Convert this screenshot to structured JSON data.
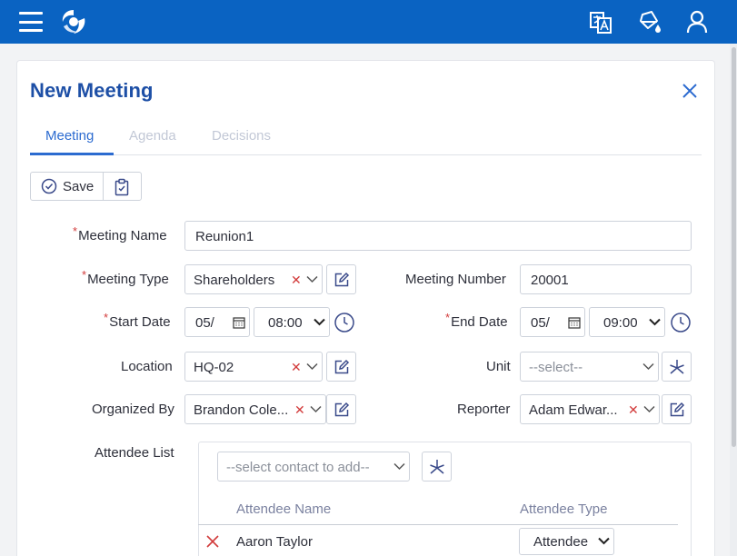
{
  "title": "New Meeting",
  "tabs": [
    {
      "label": "Meeting",
      "active": true
    },
    {
      "label": "Agenda",
      "active": false
    },
    {
      "label": "Decisions",
      "active": false
    }
  ],
  "toolbar": {
    "save_label": "Save"
  },
  "form": {
    "meeting_name": {
      "label": "Meeting Name",
      "required": true,
      "value": "Reunion1"
    },
    "meeting_type": {
      "label": "Meeting Type",
      "required": true,
      "value": "Shareholders"
    },
    "meeting_number": {
      "label": "Meeting Number",
      "value": "20001"
    },
    "start_date": {
      "label": "Start Date",
      "required": true,
      "date": "05/",
      "time": "08:00"
    },
    "end_date": {
      "label": "End Date",
      "required": true,
      "date": "05/",
      "time": "09:00"
    },
    "location": {
      "label": "Location",
      "value": "HQ-02"
    },
    "unit": {
      "label": "Unit",
      "placeholder": "--select--"
    },
    "organized_by": {
      "label": "Organized By",
      "value": "Brandon Cole..."
    },
    "reporter": {
      "label": "Reporter",
      "value": "Adam Edwar..."
    },
    "attendee_list": {
      "label": "Attendee List",
      "add_placeholder": "--select contact to add--",
      "columns": [
        "Attendee Name",
        "Attendee Type"
      ],
      "rows": [
        {
          "name": "Aaron Taylor",
          "type": "Attendee"
        }
      ]
    }
  },
  "colors": {
    "header": "#0a63c2",
    "accent": "#2c6bd0",
    "required": "#d23b3b"
  }
}
